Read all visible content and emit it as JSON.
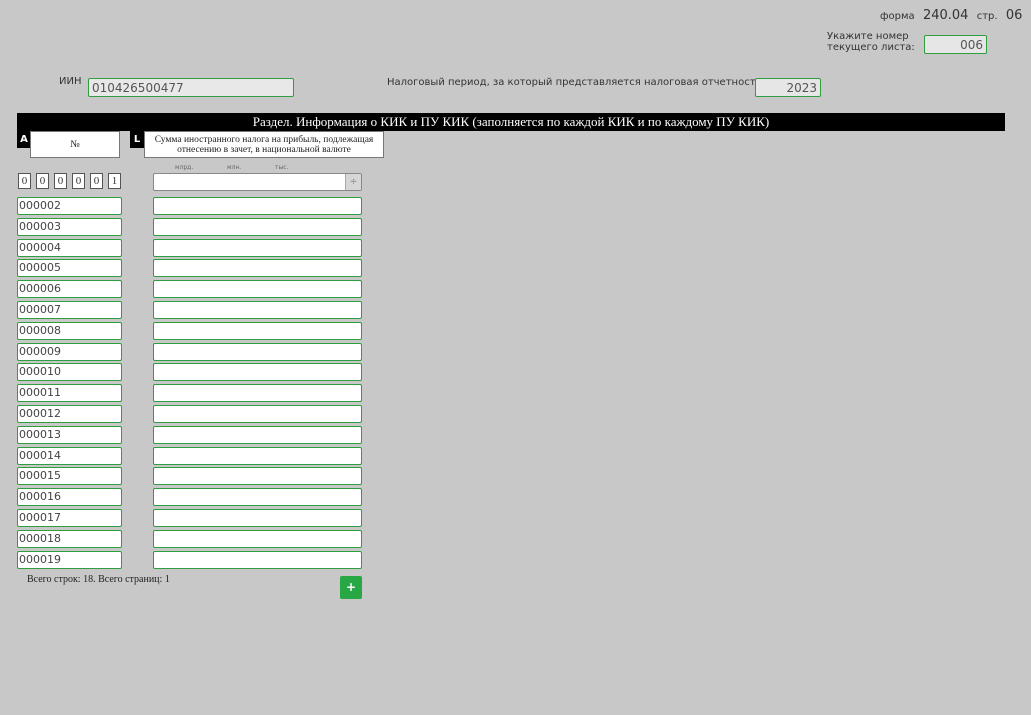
{
  "header": {
    "form_prefix": "форма",
    "form_number": "240.04",
    "page_prefix": "стр.",
    "page_number": "06",
    "sheet_label": "Укажите номер текущего листа:",
    "sheet_value": "006"
  },
  "taxpayer": {
    "iin_label": "ИИН",
    "iin_value": "010426500477",
    "period_label": "Налоговый период, за который представляется налоговая отчетность: год",
    "year_value": "2023"
  },
  "section": {
    "title": "Раздел. Информация о КИК и ПУ КИК (заполняется по каждой КИК и по каждому ПУ КИК)",
    "col_a_letter": "A",
    "col_a_header": "№",
    "col_l_letter": "L",
    "col_l_header": "Сумма иностранного налога на прибыль, подлежащая отнесению в зачет, в национальной валюте",
    "unit_labels": [
      "млрд.",
      "млн.",
      "тыс."
    ]
  },
  "first_row": {
    "digits": [
      "0",
      "0",
      "0",
      "0",
      "0",
      "1"
    ],
    "spin_icon": "÷"
  },
  "rows": [
    "000002",
    "000003",
    "000004",
    "000005",
    "000006",
    "000007",
    "000008",
    "000009",
    "000010",
    "000011",
    "000012",
    "000013",
    "000014",
    "000015",
    "000016",
    "000017",
    "000018",
    "000019"
  ],
  "footer": {
    "summary": "Всего строк: 18. Всего страниц: 1",
    "add_label": "+"
  }
}
